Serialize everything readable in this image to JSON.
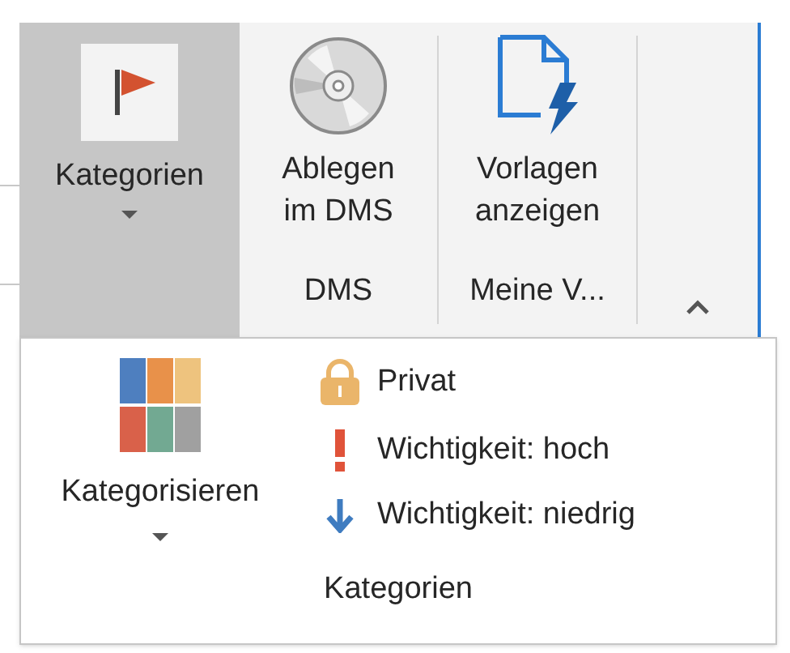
{
  "ribbon": {
    "groups": [
      {
        "buttons": [
          {
            "kind": "flag",
            "label_lines": [
              "Kategorien"
            ],
            "dropdown": true,
            "selected": true
          }
        ]
      },
      {
        "label": "DMS",
        "buttons": [
          {
            "kind": "disc",
            "label_lines": [
              "Ablegen",
              "im DMS"
            ],
            "dropdown": false,
            "selected": false
          }
        ]
      },
      {
        "label": "Meine V...",
        "buttons": [
          {
            "kind": "document",
            "label_lines": [
              "Vorlagen",
              "anzeigen"
            ],
            "dropdown": false,
            "selected": false
          }
        ]
      }
    ]
  },
  "dropdown": {
    "big_button": {
      "label": "Kategorisieren",
      "dropdown": true
    },
    "items": [
      {
        "kind": "lock",
        "label": "Privat"
      },
      {
        "kind": "high",
        "label": "Wichtigkeit: hoch"
      },
      {
        "kind": "low",
        "label": "Wichtigkeit: niedrig"
      }
    ],
    "group_label": "Kategorien"
  }
}
